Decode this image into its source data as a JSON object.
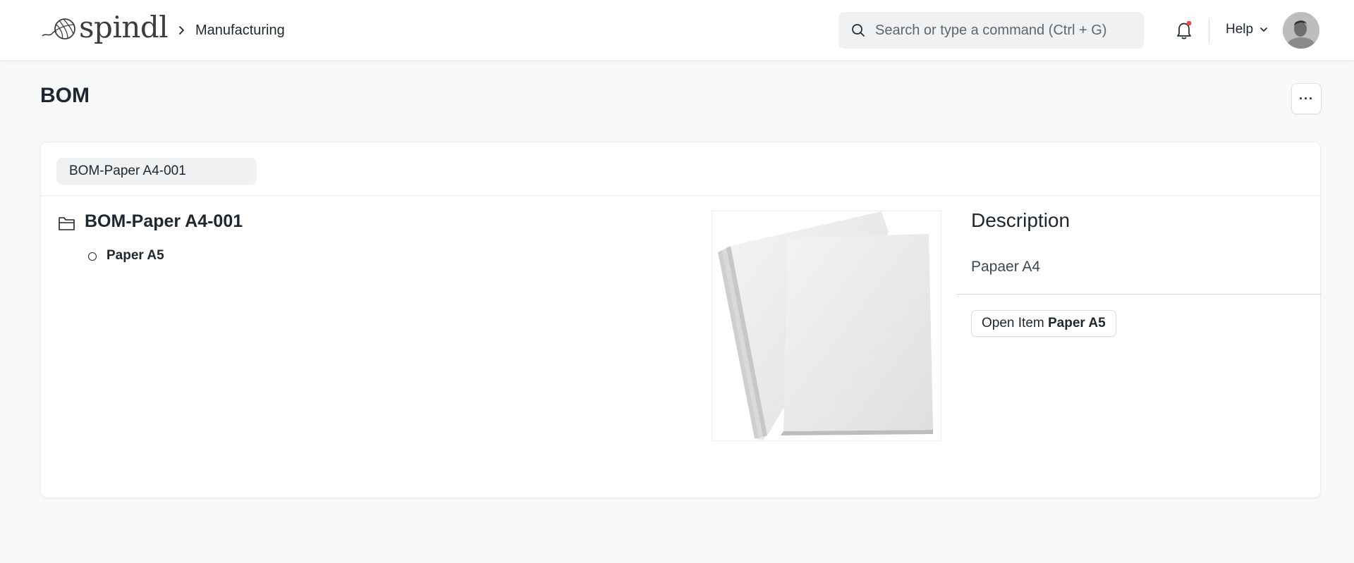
{
  "app": {
    "brand": "spindl",
    "breadcrumb": "Manufacturing"
  },
  "search": {
    "placeholder": "Search or type a command (Ctrl + G)"
  },
  "nav": {
    "help_label": "Help"
  },
  "page": {
    "title": "BOM",
    "menu_label": "···"
  },
  "bom_selector": {
    "value": "BOM-Paper A4-001"
  },
  "tree": {
    "root": "BOM-Paper A4-001",
    "children": [
      {
        "label": "Paper A5"
      }
    ]
  },
  "details": {
    "heading": "Description",
    "description": "Papaer A4",
    "open_item_prefix": "Open Item",
    "open_item_name": "Paper A5"
  },
  "icons": {
    "logo": "yarn-ball-icon",
    "breadcrumb": "chevron-right-icon",
    "search": "search-icon",
    "notifications": "bell-icon",
    "help": "chevron-down-icon",
    "tree_root": "folder-icon",
    "tree_node": "circle-icon"
  },
  "colors": {
    "notification_dot": "#e24c4c",
    "text": "#1f272e",
    "background": "#f8f9f9"
  }
}
